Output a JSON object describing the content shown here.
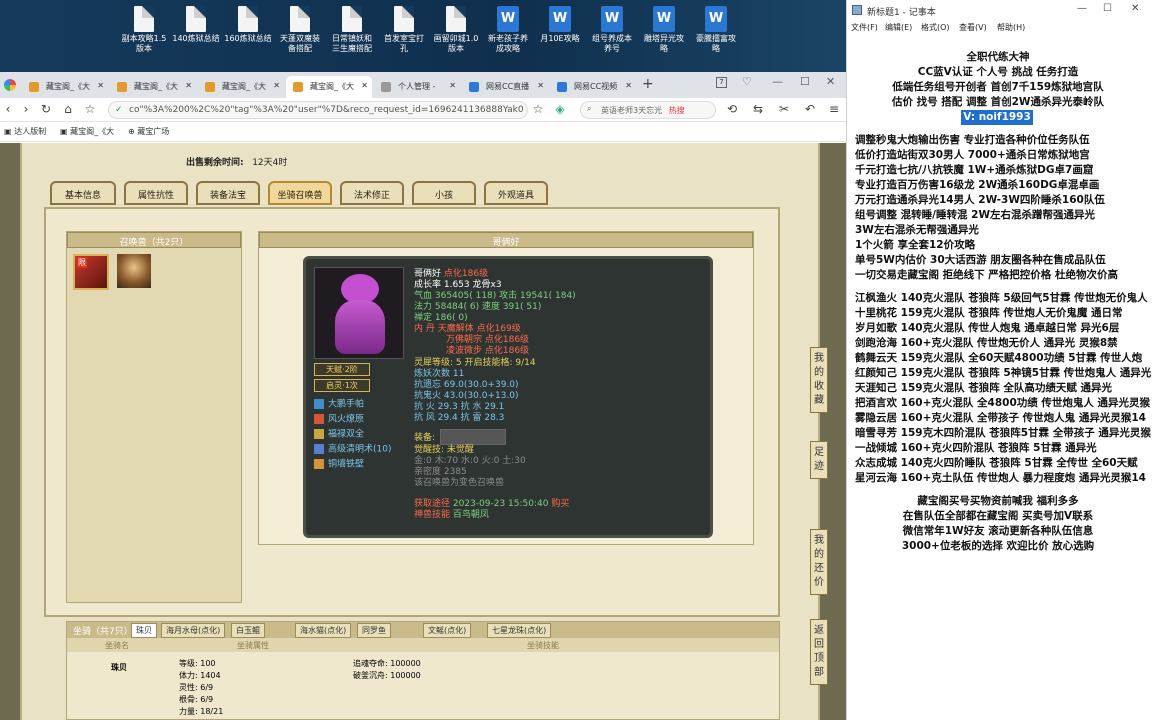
{
  "desktop": {
    "icons": [
      {
        "label": "副本攻略1.5\n版本",
        "kind": "doc"
      },
      {
        "label": "140炼狱总结",
        "kind": "doc"
      },
      {
        "label": "160炼狱总结",
        "kind": "doc"
      },
      {
        "label": "天蓬双魔装\n备搭配",
        "kind": "doc"
      },
      {
        "label": "日常镇妖和\n三生魔搭配",
        "kind": "doc"
      },
      {
        "label": "首发室宝打\n孔",
        "kind": "doc"
      },
      {
        "label": "画留卯城1.0\n版本",
        "kind": "doc"
      },
      {
        "label": "新老孩子养\n成攻略",
        "kind": "word"
      },
      {
        "label": "月10E攻略",
        "kind": "word"
      },
      {
        "label": "组号养成本\n养号",
        "kind": "word"
      },
      {
        "label": "雕塔异光攻\n略",
        "kind": "word"
      },
      {
        "label": "豪騰擂富攻\n略",
        "kind": "word"
      }
    ]
  },
  "browser": {
    "tabs": [
      "藏宝阁_《大",
      "藏宝阁_《大",
      "藏宝阁_《大",
      "藏宝阁_《大",
      "个人管理 -",
      "网易CC直播",
      "网易CC视频"
    ],
    "url": "co\"%3A%200%2C%20\"tag\"%3A%20\"user\"%7D&reco_request_id=1696241136888Yak0",
    "search_text": "英语老师3天忘光",
    "search_badge": "热搜",
    "bookmarks": [
      "达人版制",
      "藏宝阁_《大",
      "藏宝广场"
    ],
    "tab_count_badge": "7"
  },
  "page": {
    "sale_time_label": "出售剩余时间:",
    "sale_time_value": "12天4时",
    "tabs": [
      "基本信息",
      "属性抗性",
      "装备法宝",
      "坐骑召唤兽",
      "法术修正",
      "小孩",
      "外观道具"
    ],
    "active_tab": "坐骑召唤兽",
    "summon_panel_title": "召唤兽（共2只）",
    "detail_title": "哥俩好",
    "pet": {
      "name": "哥俩好",
      "tag": "点化186级",
      "growth": "成长率 1.653 龙骨x3",
      "hp": "气血 365405( 118) 攻击 19541( 184)",
      "mp": "法力 58484( 6) 速度 391( 51)",
      "spirit": "禅定 186( 0)",
      "dan": "内    丹 天魔解体 点化169级",
      "dan2": "万佛朝宗 点化186级",
      "dan3": "凌波微步 点化186级",
      "lingli": "灵犀等级: 5 开启技能格: 9/14",
      "training": "炼妖次数 11",
      "kangyi": "抗遗忘 69.0(30.0+39.0)",
      "kanghuo": "抗鬼火 43.0(30.0+13.0)",
      "kangres1": "抗  火 29.3 抗  水 29.1",
      "kangres2": "抗  风 29.4 抗  雷 28.3",
      "equip_label": "装备:",
      "juexing": "觉醒技: 未觉醒",
      "wuxing": "金:0 木:70 水:0 火:0 土:30",
      "qinmi": "亲密度 2385",
      "hint": "该召唤兽为变色召唤兽",
      "date_prefix": "获取途径",
      "date": "2023-09-23 15:50:40",
      "date_tag": "购买",
      "shenji": "神兽技能",
      "shenji_val": "百鸟朝凤",
      "tianfu": "天赋·2阶",
      "qiling": "启灵·1次",
      "skills": [
        "大鹏手帕",
        "风火燎原",
        "福禄双全",
        "高级清明术(10)",
        "铜墙铁壁"
      ]
    },
    "mount_panel_title": "坐骑（共7只）",
    "mount_tabs": [
      "珠贝",
      "海月水母(点化)",
      "白玉鲲",
      "海水猫(点化)",
      "同罗鱼",
      "文鳐(点化)",
      "七星龙珠(点化)"
    ],
    "mount_table_headers": [
      "坐骑名",
      "坐骑属性",
      "坐骑技能"
    ],
    "mount_row": {
      "name": "珠贝",
      "attrs": [
        "等级: 100",
        "体力: 1404",
        "灵性: 6/9",
        "根骨: 6/9",
        "力量: 18/21"
      ],
      "skills": [
        "追魂夺命: 100000",
        "破釜沉舟: 100000"
      ]
    },
    "side_buttons": [
      "我的收藏",
      "足迹",
      "我的还价",
      "返回顶部"
    ]
  },
  "notepad": {
    "title": "新标题1 - 记事本",
    "menu": [
      "文件(F)",
      "编辑(E)",
      "格式(O)",
      "查看(V)",
      "帮助(H)"
    ],
    "lines": [
      "全职代练大神",
      "CC蓝V认证 个人号 挑战 任务打造",
      "低端任务组号开创者          首创7千159炼狱地宫队",
      "估价 找号 搭配 调整           首创2W通杀异光泰岭队",
      "V: noif1993",
      "",
      "调整秒鬼大炮输出伤害          专业打造各种价位任务队伍",
      "低价打造站街双30男人          7000+通杀日常炼狱地宫",
      "千元打造七抗/八抗铁魔          1W+通杀炼狱DG卓7画窟",
      "专业打造百万伤害16级龙         2W通杀160DG卓混卓画",
      "万元打造通杀异光14男人         2W-3W四阶睡杀160队伍",
      "组号调整 混转睡/睡转混         2W左右混杀蹭帮强通异光",
      "                           3W左右混杀无帮强通异光",
      "1个火箭 享全套12价攻略",
      "单号5W内估价 30大话西游        朋友圈各种在售成品队伍",
      "一切交易走藏宝阁 拒绝线下     严格把控价格 杜绝物次价高",
      "",
      "江枫渔火 140克火混队 苍狼阵 5级回气5甘霖 传世炮无价鬼人",
      "十里桃花 159克火混队 苍狼阵 传世炮人无价鬼魔 通日常",
      "岁月如歌 140克火混队 传世人炮鬼 通卓越日常 异光6层",
      "剑跑沧海 160+克火混队 传世炮无价人 通异光 灵猴8禁",
      "鹤舞云天 159克火混队 全60天赋4800功绩 5甘霖 传世人炮",
      "红颜知己 159克火混队 苍狼阵 5神镜5甘霖 传世炮鬼人 通异光",
      "天涯知己 159克火混队 苍狼阵 全队高功绩天赋 通异光",
      "把酒言欢 160+克火混队 全4800功绩 传世炮鬼人 通异光灵猴",
      "雾隐云居 160+克火混队 全带孩子 传世炮人鬼 通异光灵猴14",
      "暗雪寻芳 159克木四阶混队 苍狼阵5甘霖 全带孩子 通异光灵猴",
      "一战倾城 160+克火四阶混队 苍狼阵 5甘霖 通异光",
      "众志成城 140克火四阶睡队 苍狼阵 5甘霖 全传世 全60天赋",
      "星河云海 160+克土队伍 传世炮人 暴力程度炮 通异光灵猴14",
      "",
      "藏宝阁买号买物资前喊我 福利多多",
      "在售队伍全部都在藏宝阁 买卖号加V联系",
      "微信常年1W好友 滚动更新各种队伍信息",
      "3000+位老板的选择 欢迎比价 放心选购"
    ]
  }
}
